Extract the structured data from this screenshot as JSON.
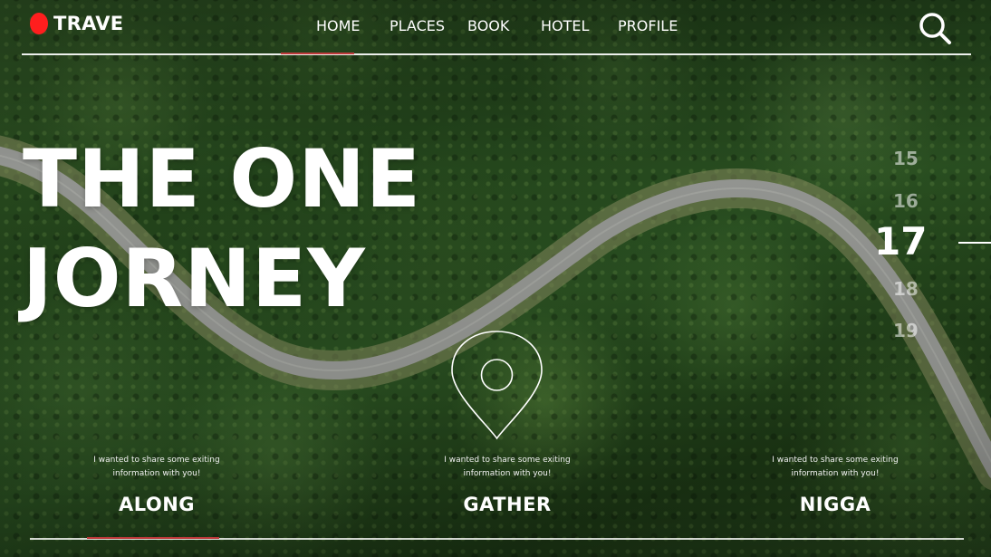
{
  "brand": {
    "name": "TRAVE",
    "accent_color": "#ff1e1e"
  },
  "nav": {
    "items": [
      {
        "label": "HOME"
      },
      {
        "label": "PLACES"
      },
      {
        "label": "BOOK"
      },
      {
        "label": "HOTEL"
      },
      {
        "label": "PROFILE"
      }
    ],
    "active": "HOME",
    "search_icon": "search-icon"
  },
  "hero": {
    "line1": "THE ONE",
    "line2": "JORNEY"
  },
  "dates": {
    "items": [
      "15",
      "16",
      "17",
      "18",
      "19"
    ],
    "active": "17"
  },
  "pin_icon": "location-pin-icon",
  "features": [
    {
      "desc_line1": "I wanted to share some exiting",
      "desc_line2": "information with you!",
      "title": "ALONG"
    },
    {
      "desc_line1": "I wanted to share some exiting",
      "desc_line2": "information with you!",
      "title": "GATHER"
    },
    {
      "desc_line1": "I wanted to share some exiting",
      "desc_line2": "information with you!",
      "title": "NIGGA"
    }
  ],
  "colors": {
    "underline_active": "#c0393b",
    "text": "#ffffff"
  }
}
